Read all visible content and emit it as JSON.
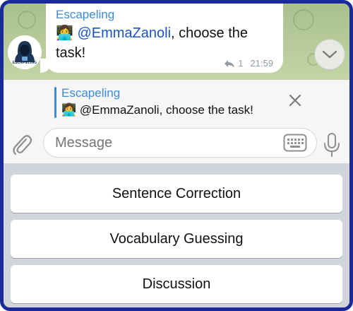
{
  "message": {
    "sender": "Escapeling",
    "emoji": "👩‍💻",
    "mention": "@EmmaZanoli",
    "text": ", choose the task!",
    "reply_count": "1",
    "time": "21:59"
  },
  "avatar": {
    "label": "ESCAPELING"
  },
  "reply_preview": {
    "sender": "Escapeling",
    "emoji": "👩‍💻",
    "text": "@EmmaZanoli, choose the task!"
  },
  "composer": {
    "placeholder": "Message"
  },
  "keyboard": {
    "buttons": [
      "Sentence Correction",
      "Vocabulary Guessing",
      "Discussion"
    ]
  },
  "colors": {
    "accent": "#3d8bd6",
    "mention": "#1a53c7",
    "frame": "#1a2a9a"
  }
}
